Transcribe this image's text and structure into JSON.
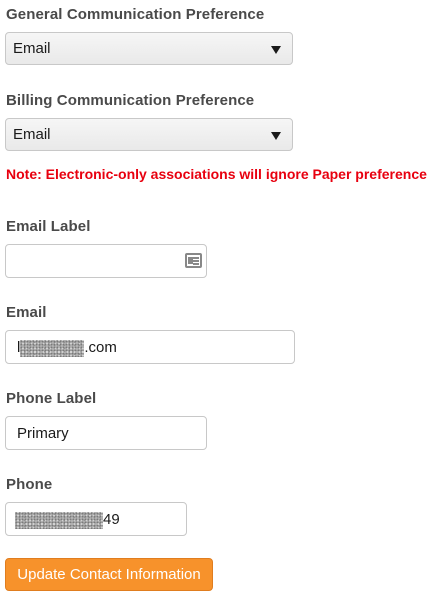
{
  "general_pref": {
    "label": "General Communication Preference",
    "selected": "Email"
  },
  "billing_pref": {
    "label": "Billing Communication Preference",
    "selected": "Email"
  },
  "note": "Note: Electronic-only associations will ignore Paper preference",
  "email_label_field": {
    "label": "Email Label",
    "value": "",
    "icon": "contact-card-icon"
  },
  "email_field": {
    "label": "Email",
    "value_prefix": "l",
    "value_suffix": ".com"
  },
  "phone_label_field": {
    "label": "Phone Label",
    "value": "Primary"
  },
  "phone_field": {
    "label": "Phone",
    "value_suffix": "49"
  },
  "submit_button": {
    "label": "Update Contact Information"
  },
  "colors": {
    "note_text": "#e8000f",
    "button_bg": "#f7922b",
    "label_text": "#4a4a4a"
  }
}
